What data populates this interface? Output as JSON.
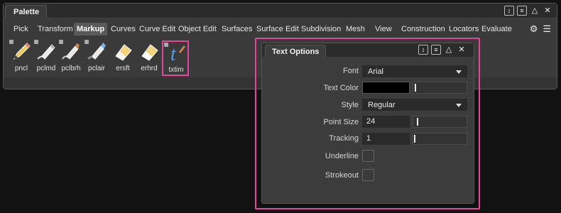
{
  "palette": {
    "title": "Palette",
    "shelf_tabs": [
      "Pick",
      "Transform",
      "Markup",
      "Curves",
      "Curve Edit",
      "Object Edit",
      "Surfaces",
      "Surface Edit",
      "Subdivision",
      "Mesh",
      "View",
      "Construction",
      "Locators",
      "Evaluate"
    ],
    "active_tab": "Markup",
    "tools": [
      {
        "label": "pncl",
        "icon": "pencil-icon"
      },
      {
        "label": "pclmd",
        "icon": "marker-pencil-icon"
      },
      {
        "label": "pclbrh",
        "icon": "brush-pencil-icon"
      },
      {
        "label": "pclair",
        "icon": "airbrush-pencil-icon"
      },
      {
        "label": "ersft",
        "icon": "soft-eraser-icon"
      },
      {
        "label": "erhrd",
        "icon": "hard-eraser-icon"
      },
      {
        "label": "txtim",
        "icon": "text-tool-icon"
      }
    ]
  },
  "text_options": {
    "title": "Text Options",
    "font_label": "Font",
    "font_value": "Arial",
    "text_color_label": "Text Color",
    "text_color_value": "#000000",
    "style_label": "Style",
    "style_value": "Regular",
    "point_size_label": "Point Size",
    "point_size_value": "24",
    "tracking_label": "Tracking",
    "tracking_value": "1",
    "underline_label": "Underline",
    "strokeout_label": "Strokeout"
  },
  "colors": {
    "highlight": "#e2479a",
    "accent_blue": "#4a90d9"
  }
}
